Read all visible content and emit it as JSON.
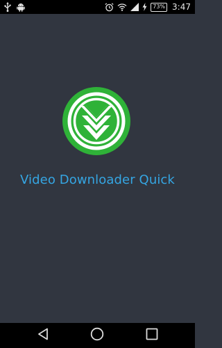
{
  "status_bar": {
    "icons": [
      "usb-icon",
      "android-icon",
      "alarm-icon",
      "wifi-icon",
      "signal-icon",
      "charging-icon",
      "battery-icon"
    ],
    "battery_percent": "73",
    "time": "3:47"
  },
  "app": {
    "name": "Video Downloader Quick",
    "logo_icon": "download-chevrons-icon",
    "colors": {
      "background": "#313640",
      "title": "#35a6e3",
      "logo_green": "#2fb238"
    }
  },
  "nav_bar": {
    "buttons": [
      "back-icon",
      "home-icon",
      "recents-icon"
    ]
  }
}
